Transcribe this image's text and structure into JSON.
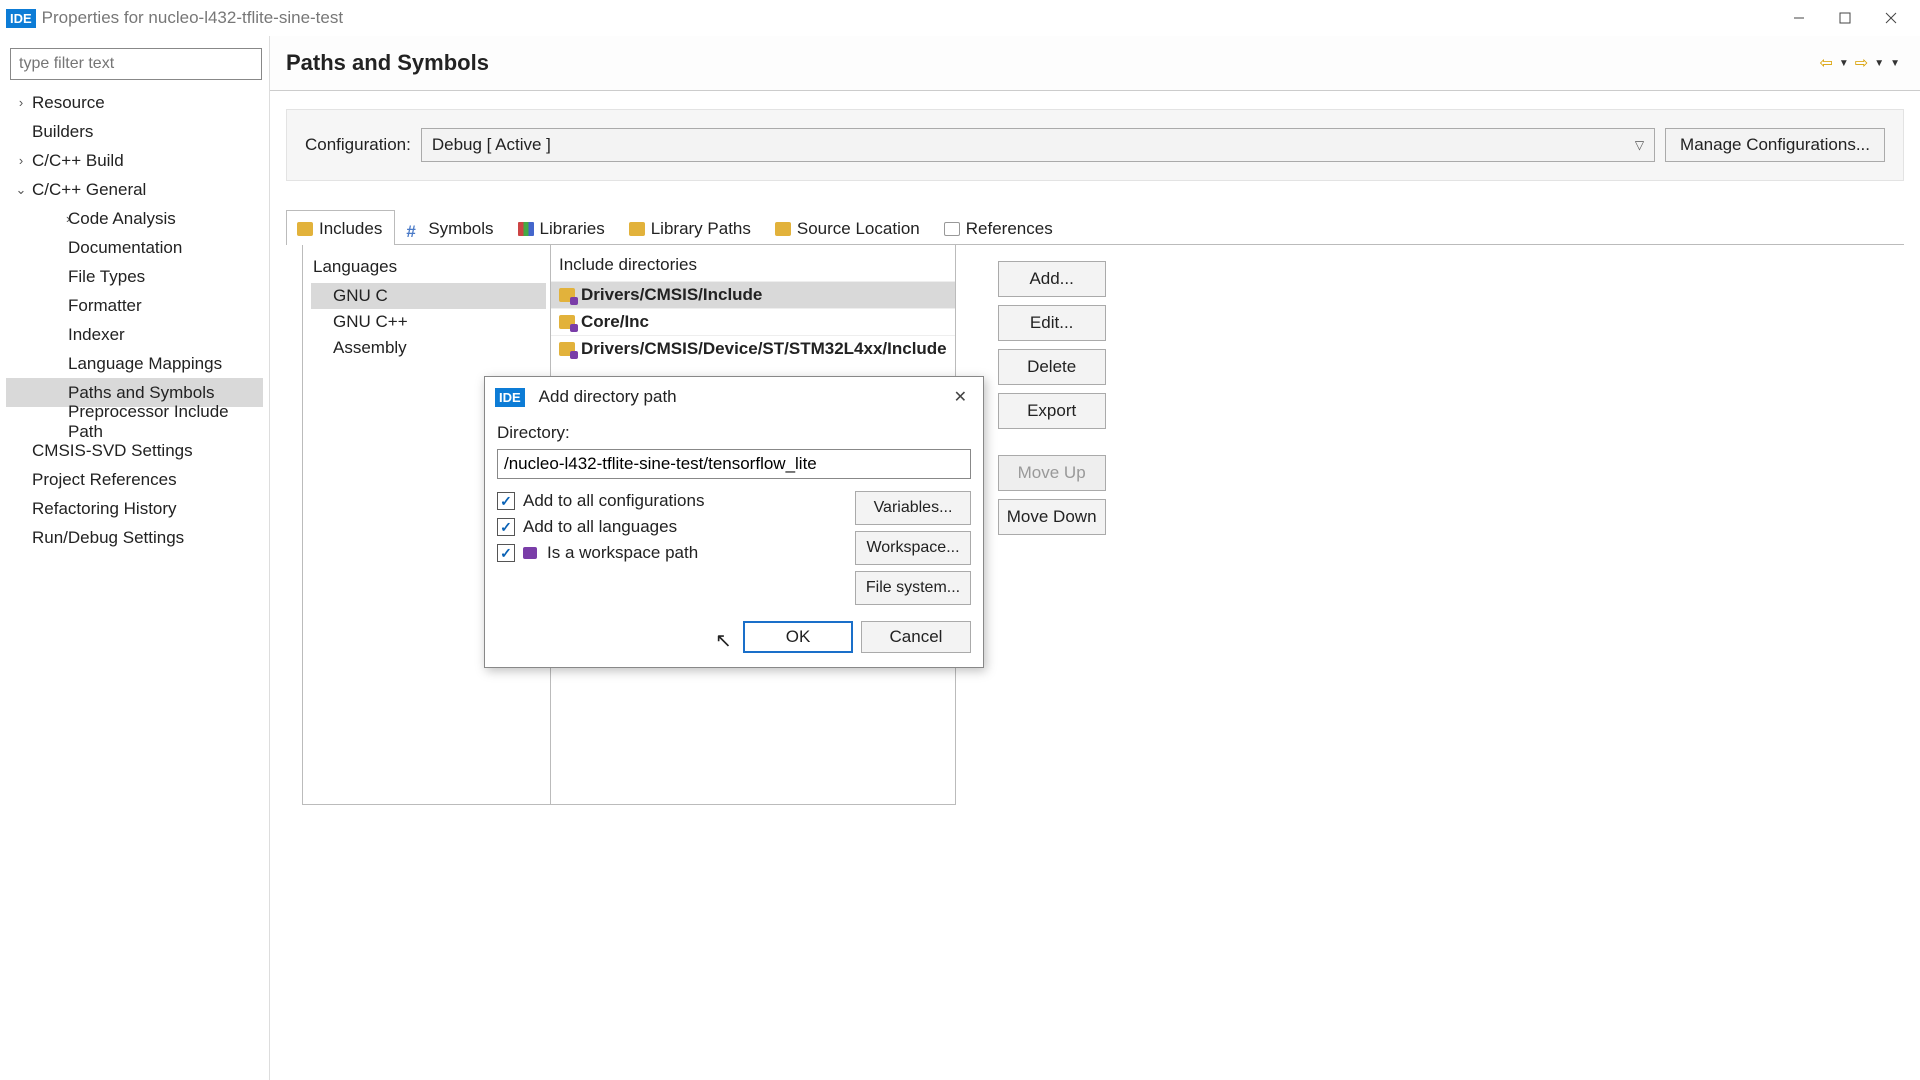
{
  "window": {
    "badge": "IDE",
    "title": "Properties for nucleo-l432-tflite-sine-test"
  },
  "sidebar": {
    "filter_placeholder": "type filter text",
    "items": [
      {
        "label": "Resource",
        "expandable": true,
        "expanded": false,
        "indent": 0
      },
      {
        "label": "Builders",
        "expandable": false,
        "indent": 0
      },
      {
        "label": "C/C++ Build",
        "expandable": true,
        "expanded": false,
        "indent": 0
      },
      {
        "label": "C/C++ General",
        "expandable": true,
        "expanded": true,
        "indent": 0
      },
      {
        "label": "Code Analysis",
        "expandable": true,
        "expanded": false,
        "indent": 1
      },
      {
        "label": "Documentation",
        "expandable": false,
        "indent": 1
      },
      {
        "label": "File Types",
        "expandable": false,
        "indent": 1
      },
      {
        "label": "Formatter",
        "expandable": false,
        "indent": 1
      },
      {
        "label": "Indexer",
        "expandable": false,
        "indent": 1
      },
      {
        "label": "Language Mappings",
        "expandable": false,
        "indent": 1
      },
      {
        "label": "Paths and Symbols",
        "expandable": false,
        "indent": 1,
        "selected": true
      },
      {
        "label": "Preprocessor Include Path",
        "expandable": false,
        "indent": 1
      },
      {
        "label": "CMSIS-SVD Settings",
        "expandable": false,
        "indent": 0
      },
      {
        "label": "Project References",
        "expandable": false,
        "indent": 0
      },
      {
        "label": "Refactoring History",
        "expandable": false,
        "indent": 0
      },
      {
        "label": "Run/Debug Settings",
        "expandable": false,
        "indent": 0
      }
    ]
  },
  "main": {
    "title": "Paths and Symbols",
    "config_label": "Configuration:",
    "config_value": "Debug  [ Active ]",
    "manage_btn": "Manage Configurations...",
    "tabs": [
      {
        "label": "Includes",
        "active": true
      },
      {
        "label": "Symbols"
      },
      {
        "label": "Libraries"
      },
      {
        "label": "Library Paths"
      },
      {
        "label": "Source Location"
      },
      {
        "label": "References"
      }
    ],
    "lang_title": "Languages",
    "languages": [
      {
        "label": "GNU C",
        "selected": true
      },
      {
        "label": "GNU C++"
      },
      {
        "label": "Assembly"
      }
    ],
    "dir_title": "Include directories",
    "directories": [
      {
        "label": "Drivers/CMSIS/Include",
        "selected": true
      },
      {
        "label": "Core/Inc"
      },
      {
        "label": "Drivers/CMSIS/Device/ST/STM32L4xx/Include"
      }
    ],
    "side_buttons": {
      "add": "Add...",
      "edit": "Edit...",
      "delete": "Delete",
      "export": "Export",
      "move_up": "Move Up",
      "move_down": "Move Down"
    }
  },
  "dialog": {
    "badge": "IDE",
    "title": "Add directory path",
    "dir_label": "Directory:",
    "dir_value": "/nucleo-l432-tflite-sine-test/tensorflow_lite",
    "checks": {
      "all_configs": "Add to all configurations",
      "all_langs": "Add to all languages",
      "workspace": "Is a workspace path"
    },
    "side": {
      "variables": "Variables...",
      "workspace": "Workspace...",
      "filesystem": "File system..."
    },
    "ok": "OK",
    "cancel": "Cancel"
  }
}
